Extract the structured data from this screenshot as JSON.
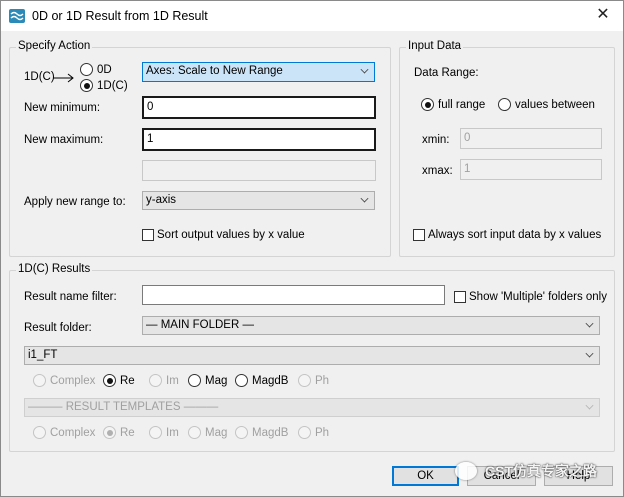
{
  "window": {
    "title": "0D or 1D Result from 1D Result",
    "close": "✕"
  },
  "specify_action": {
    "group_label": "Specify Action",
    "source_label": "1D(C)",
    "target_options": [
      "0D",
      "1D(C)"
    ],
    "action_select": "Axes: Scale to New Range",
    "new_minimum_label": "New minimum:",
    "new_minimum_value": "0",
    "new_maximum_label": "New maximum:",
    "new_maximum_value": "1",
    "extra_field_value": "",
    "apply_label": "Apply new range to:",
    "apply_select": "y-axis",
    "sort_checkbox_label": "Sort output values by x value"
  },
  "input_data": {
    "group_label": "Input Data",
    "data_range_label": "Data Range:",
    "range_options": [
      "full range",
      "values between"
    ],
    "xmin_label": "xmin:",
    "xmin_value": "0",
    "xmax_label": "xmax:",
    "xmax_value": "1",
    "always_sort_label": "Always sort input data by x values"
  },
  "results": {
    "group_label": "1D(C) Results",
    "filter_label": "Result name filter:",
    "filter_value": "",
    "multiple_label": "Show 'Multiple' folders only",
    "folder_label": "Result folder:",
    "folder_select": "— MAIN FOLDER —",
    "result_select": "i1_FT",
    "format_options": [
      "Complex",
      "Re",
      "Im",
      "Mag",
      "MagdB",
      "Ph"
    ],
    "templates_select": "——— RESULT TEMPLATES ———",
    "template_format_options": [
      "Complex",
      "Re",
      "Im",
      "Mag",
      "MagdB",
      "Ph"
    ]
  },
  "buttons": {
    "ok": "OK",
    "cancel": "Cancel",
    "help": "Help"
  },
  "watermark": {
    "text": "CST仿真专家之路"
  }
}
